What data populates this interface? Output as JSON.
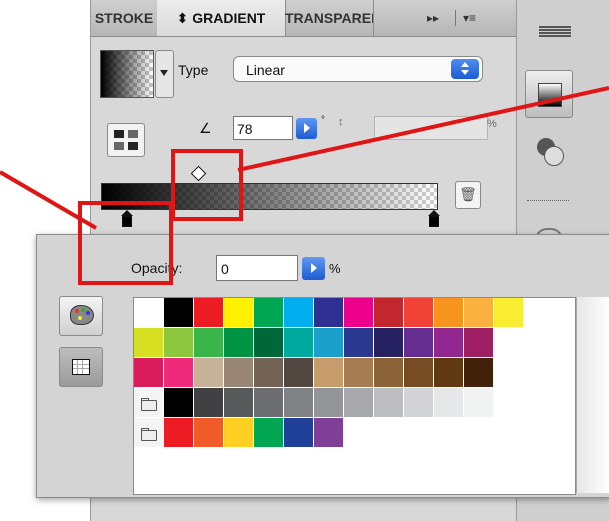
{
  "tabs": {
    "stroke": "STROKE",
    "gradient": "⬍ GRADIENT",
    "trans": "TRANSPARENCY"
  },
  "tab_controls": {
    "expand": "▸▸",
    "menu": "▾≡"
  },
  "gradient": {
    "type_label": "Type",
    "type_value": "Linear",
    "angle_value": "78",
    "degree_symbol": "°",
    "aspect_percent": "%"
  },
  "opacity": {
    "label": "Opacity:",
    "value": "0",
    "unit": "%"
  },
  "icons": {
    "trash": "🗑",
    "angle": "∠",
    "aspect": "↕"
  },
  "swatches": {
    "row1": [
      "#ffffff",
      "#000000",
      "#ed1c24",
      "#fff200",
      "#00a651",
      "#00aeef",
      "#2e3192",
      "#ec008c",
      "#c1272d",
      "#ef4136",
      "#f7941d",
      "#fbb040",
      "#f9ed32"
    ],
    "row2": [
      "#d7df23",
      "#8dc63f",
      "#39b54a",
      "#009444",
      "#006838",
      "#00a99d",
      "#1b9fcb",
      "#2b3990",
      "#262262",
      "#662d91",
      "#92278f",
      "#9e1f63"
    ],
    "row3": [
      "#da1c5c",
      "#ee2a7b",
      "#c7b299",
      "#998675",
      "#736357",
      "#534741",
      "#c69c6d",
      "#a67c52",
      "#8c6239",
      "#754c24",
      "#603913",
      "#42210b"
    ],
    "row4": [
      "folder",
      "#000000",
      "#414042",
      "#58595b",
      "#6d6e71",
      "#808285",
      "#939598",
      "#a7a9ac",
      "#bcbec0",
      "#d1d3d4",
      "#e6e7e8",
      "#f1f2f2"
    ],
    "row5": [
      "folder",
      "#ed1c24",
      "#f15a29",
      "#fdd023",
      "#00a651",
      "#21409a",
      "#7f3f98"
    ]
  },
  "annotation_color": "#e01515"
}
